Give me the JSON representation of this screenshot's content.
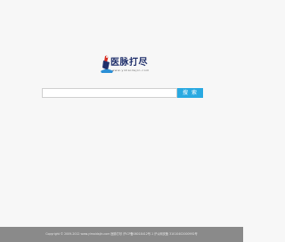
{
  "logo": {
    "name": "医脉打尽",
    "domain": "www.yimaidajin.com"
  },
  "search": {
    "value": "",
    "placeholder": "",
    "button_label": "搜 索"
  },
  "footer": {
    "text": "Copyright © 2009-2012 www.yimaidajin.com 医脉打尽 沪ICP备08018412号-1 沪公网安备 31010402000992号"
  },
  "colors": {
    "background": "#f7f7f7",
    "accent": "#29a9e1",
    "footer": "#8a8a8a",
    "logo_text": "#1f2f6b"
  }
}
